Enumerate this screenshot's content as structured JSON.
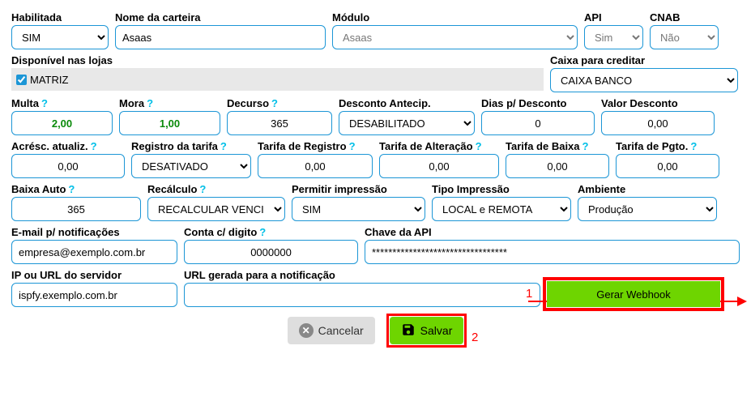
{
  "row1": {
    "habilitada": {
      "label": "Habilitada",
      "value": "SIM"
    },
    "nome": {
      "label": "Nome da carteira",
      "value": "Asaas"
    },
    "modulo": {
      "label": "Módulo",
      "value": "Asaas"
    },
    "api": {
      "label": "API",
      "value": "Sim"
    },
    "cnab": {
      "label": "CNAB",
      "value": "Não"
    }
  },
  "row2": {
    "lojas": {
      "label": "Disponível nas lojas",
      "matriz": "MATRIZ"
    },
    "caixa": {
      "label": "Caixa para creditar",
      "value": "CAIXA BANCO"
    }
  },
  "row3": {
    "multa": {
      "label": "Multa",
      "value": "2,00"
    },
    "mora": {
      "label": "Mora",
      "value": "1,00"
    },
    "decurso": {
      "label": "Decurso",
      "value": "365"
    },
    "desconto": {
      "label": "Desconto Antecip.",
      "value": "DESABILITADO"
    },
    "dias": {
      "label": "Dias p/ Desconto",
      "value": "0"
    },
    "valor": {
      "label": "Valor Desconto",
      "value": "0,00"
    }
  },
  "row4": {
    "acresc": {
      "label": "Acrésc. atualiz.",
      "value": "0,00"
    },
    "registro": {
      "label": "Registro da tarifa",
      "value": "DESATIVADO"
    },
    "tarifaReg": {
      "label": "Tarifa de Registro",
      "value": "0,00"
    },
    "tarifaAlt": {
      "label": "Tarifa de Alteração",
      "value": "0,00"
    },
    "tarifaBaixa": {
      "label": "Tarifa de Baixa",
      "value": "0,00"
    },
    "tarifaPgto": {
      "label": "Tarifa de Pgto.",
      "value": "0,00"
    }
  },
  "row5": {
    "baixa": {
      "label": "Baixa Auto",
      "value": "365"
    },
    "recalc": {
      "label": "Recálculo",
      "value": "RECALCULAR VENCI"
    },
    "permitir": {
      "label": "Permitir impressão",
      "value": "SIM"
    },
    "tipo": {
      "label": "Tipo Impressão",
      "value": "LOCAL e REMOTA"
    },
    "ambiente": {
      "label": "Ambiente",
      "value": "Produção"
    }
  },
  "row6": {
    "email": {
      "label": "E-mail p/ notificações",
      "value": "empresa@exemplo.com.br"
    },
    "conta": {
      "label": "Conta c/ digito",
      "value": "0000000"
    },
    "chave": {
      "label": "Chave da API",
      "value": "*********************************"
    }
  },
  "row7": {
    "ip": {
      "label": "IP ou URL do servidor",
      "value": "ispfy.exemplo.com.br"
    },
    "url": {
      "label": "URL gerada para a notificação",
      "value": ""
    },
    "gerar": "Gerar Webhook"
  },
  "buttons": {
    "cancelar": "Cancelar",
    "salvar": "Salvar"
  },
  "annotations": {
    "one": "1",
    "two": "2"
  }
}
